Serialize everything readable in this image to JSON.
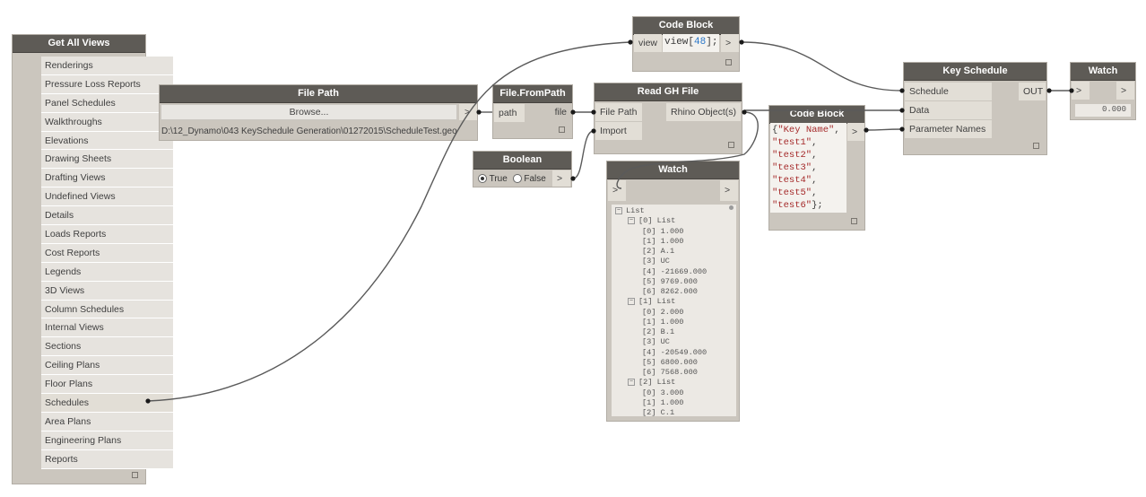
{
  "nodes": {
    "get_all_views": {
      "title": "Get All Views",
      "items": [
        "Renderings",
        "Pressure Loss Reports",
        "Panel Schedules",
        "Walkthroughs",
        "Elevations",
        "Drawing Sheets",
        "Drafting Views",
        "Undefined Views",
        "Details",
        "Loads Reports",
        "Cost Reports",
        "Legends",
        "3D Views",
        "Column Schedules",
        "Internal Views",
        "Sections",
        "Ceiling Plans",
        "Floor Plans",
        "Schedules",
        "Area Plans",
        "Engineering Plans",
        "Reports"
      ],
      "selected": "Schedules"
    },
    "file_path": {
      "title": "File Path",
      "browse_label": "Browse...",
      "output": ">",
      "path_value": "D:\\12_Dynamo\\043 KeySchedule Generation\\01272015\\ScheduleTest.geo"
    },
    "file_from_path": {
      "title": "File.FromPath",
      "input": "path",
      "output": "file"
    },
    "boolean": {
      "title": "Boolean",
      "true_label": "True",
      "false_label": "False",
      "selected": "True",
      "output": ">"
    },
    "code_block_top": {
      "title": "Code Block",
      "input": "view",
      "code_prefix": "view[",
      "code_number": "48",
      "code_suffix": "];",
      "output": ">"
    },
    "read_gh_file": {
      "title": "Read GH File",
      "inputs": [
        "File Path",
        "Import"
      ],
      "output": "Rhino Object(s)"
    },
    "watch_main": {
      "title": "Watch",
      "input": ">",
      "output": ">",
      "tree": [
        {
          "indent": 0,
          "box": "−",
          "text": "List"
        },
        {
          "indent": 1,
          "box": "−",
          "text": "[0] List"
        },
        {
          "indent": 2,
          "box": "",
          "text": "[0] 1.000"
        },
        {
          "indent": 2,
          "box": "",
          "text": "[1] 1.000"
        },
        {
          "indent": 2,
          "box": "",
          "text": "[2] A.1"
        },
        {
          "indent": 2,
          "box": "",
          "text": "[3] UC"
        },
        {
          "indent": 2,
          "box": "",
          "text": "[4] -21669.000"
        },
        {
          "indent": 2,
          "box": "",
          "text": "[5] 9769.000"
        },
        {
          "indent": 2,
          "box": "",
          "text": "[6] 8262.000"
        },
        {
          "indent": 1,
          "box": "−",
          "text": "[1] List"
        },
        {
          "indent": 2,
          "box": "",
          "text": "[0] 2.000"
        },
        {
          "indent": 2,
          "box": "",
          "text": "[1] 1.000"
        },
        {
          "indent": 2,
          "box": "",
          "text": "[2] B.1"
        },
        {
          "indent": 2,
          "box": "",
          "text": "[3] UC"
        },
        {
          "indent": 2,
          "box": "",
          "text": "[4] -20549.000"
        },
        {
          "indent": 2,
          "box": "",
          "text": "[5] 6800.000"
        },
        {
          "indent": 2,
          "box": "",
          "text": "[6] 7568.000"
        },
        {
          "indent": 1,
          "box": "−",
          "text": "[2] List"
        },
        {
          "indent": 2,
          "box": "",
          "text": "[0] 3.000"
        },
        {
          "indent": 2,
          "box": "",
          "text": "[1] 1.000"
        },
        {
          "indent": 2,
          "box": "",
          "text": "[2] C.1"
        }
      ]
    },
    "code_block_mid": {
      "title": "Code Block",
      "lines": [
        "{\"Key Name\",",
        "\"test1\",",
        "\"test2\",",
        "\"test3\",",
        "\"test4\",",
        "\"test5\",",
        "\"test6\"};"
      ],
      "output": ">"
    },
    "key_schedule": {
      "title": "Key Schedule",
      "inputs": [
        "Schedule",
        "Data",
        "Parameter Names"
      ],
      "output": "OUT"
    },
    "watch_small": {
      "title": "Watch",
      "input": ">",
      "output": ">",
      "value": "0.000"
    }
  },
  "colors": {
    "canvas": "#ffffff",
    "node_body": "#cbc6be",
    "node_header": "#5e5b56",
    "wire": "#555555",
    "number": "#2a77c9",
    "string": "#a52a2a"
  }
}
